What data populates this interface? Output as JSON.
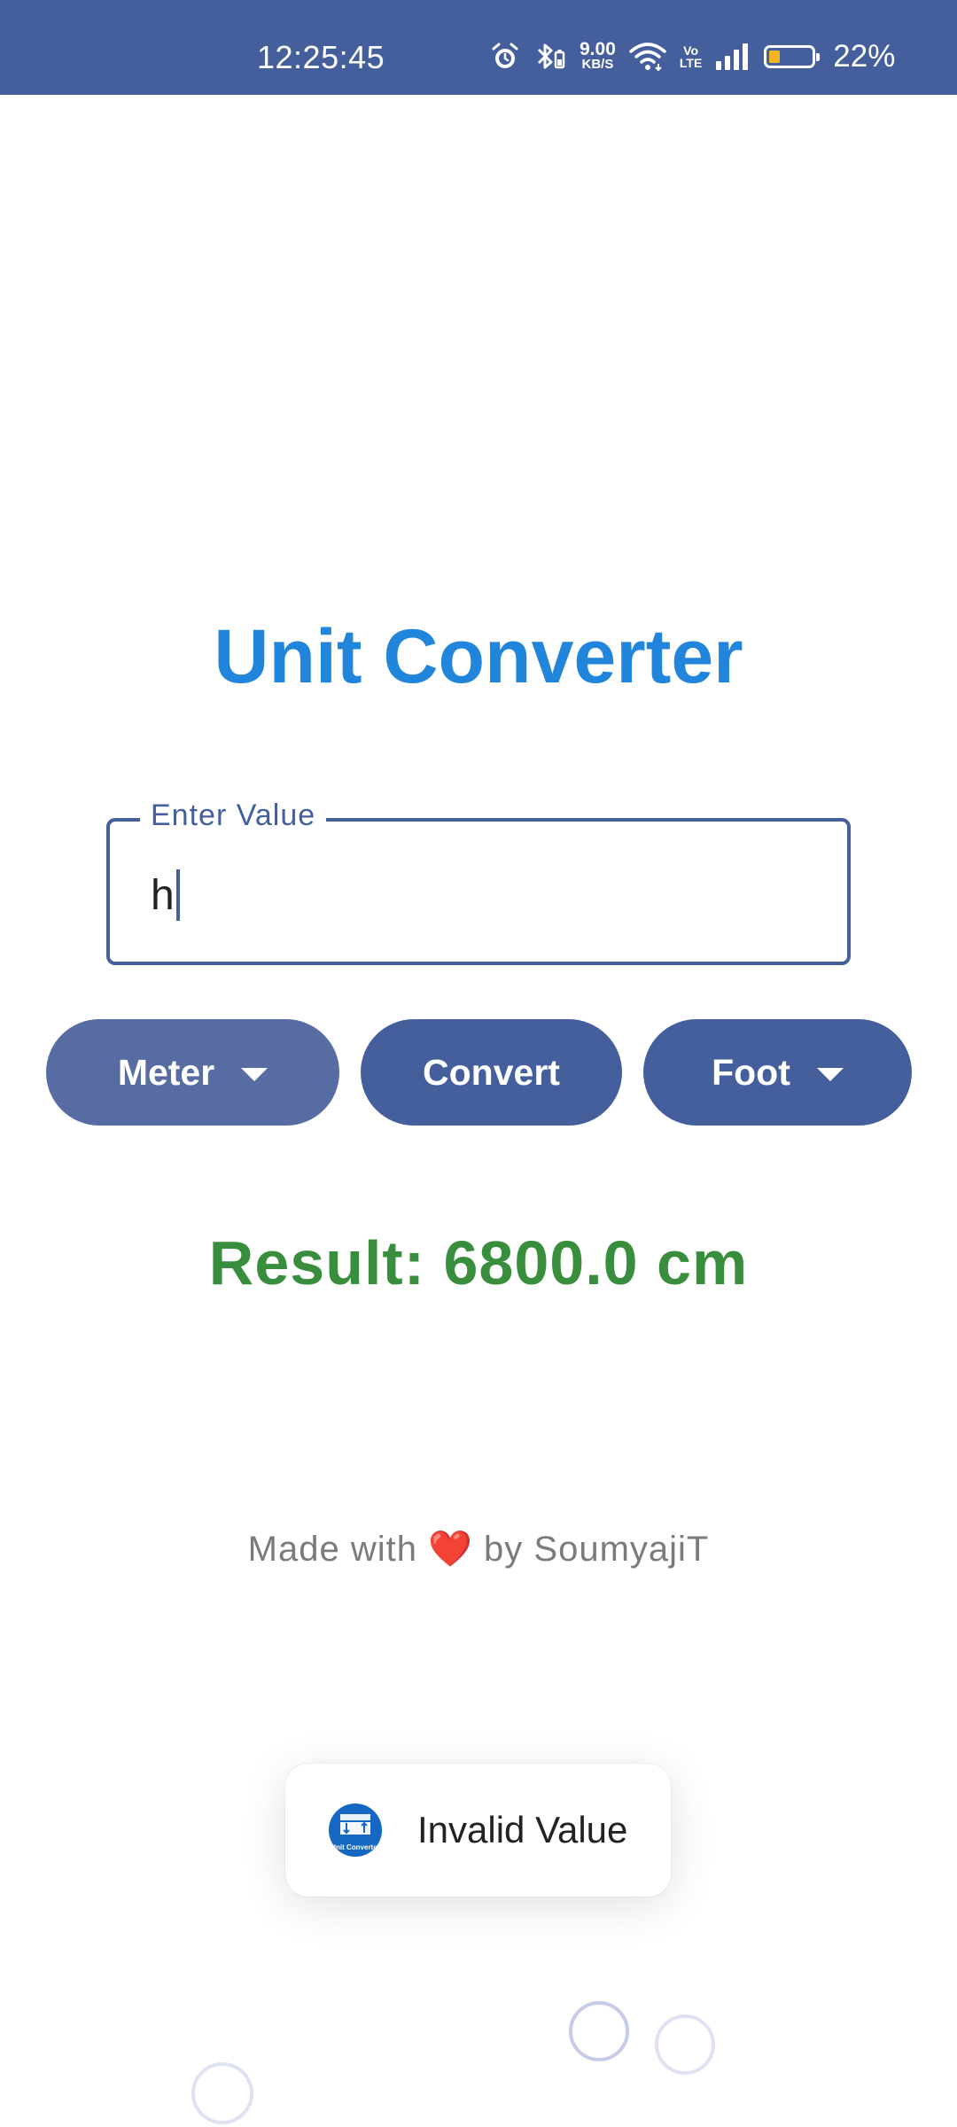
{
  "status_bar": {
    "time": "12:25:45",
    "net_speed_value": "9.00",
    "net_speed_unit": "KB/S",
    "volte_top": "Vo",
    "volte_bottom": "LTE",
    "battery_percent": "22%",
    "battery_level": 0.22,
    "background_color": "#455f9d",
    "icons": [
      "alarm-icon",
      "bluetooth-icon",
      "wifi-icon",
      "volte-icon",
      "signal-icon",
      "battery-icon"
    ]
  },
  "app": {
    "title": "Unit Converter",
    "title_color": "#2185dc"
  },
  "input": {
    "label": "Enter Value",
    "value": "h"
  },
  "buttons": {
    "from_unit": "Meter",
    "convert": "Convert",
    "to_unit": "Foot",
    "accent_color": "#455f9d"
  },
  "result": {
    "text": "Result: 6800.0 cm",
    "color": "#388e3c"
  },
  "footer": {
    "prefix": "Made with",
    "heart": "❤️",
    "suffix": "by SoumyajiT"
  },
  "toast": {
    "message": "Invalid Value",
    "app_icon_label": "Unit Converter"
  }
}
